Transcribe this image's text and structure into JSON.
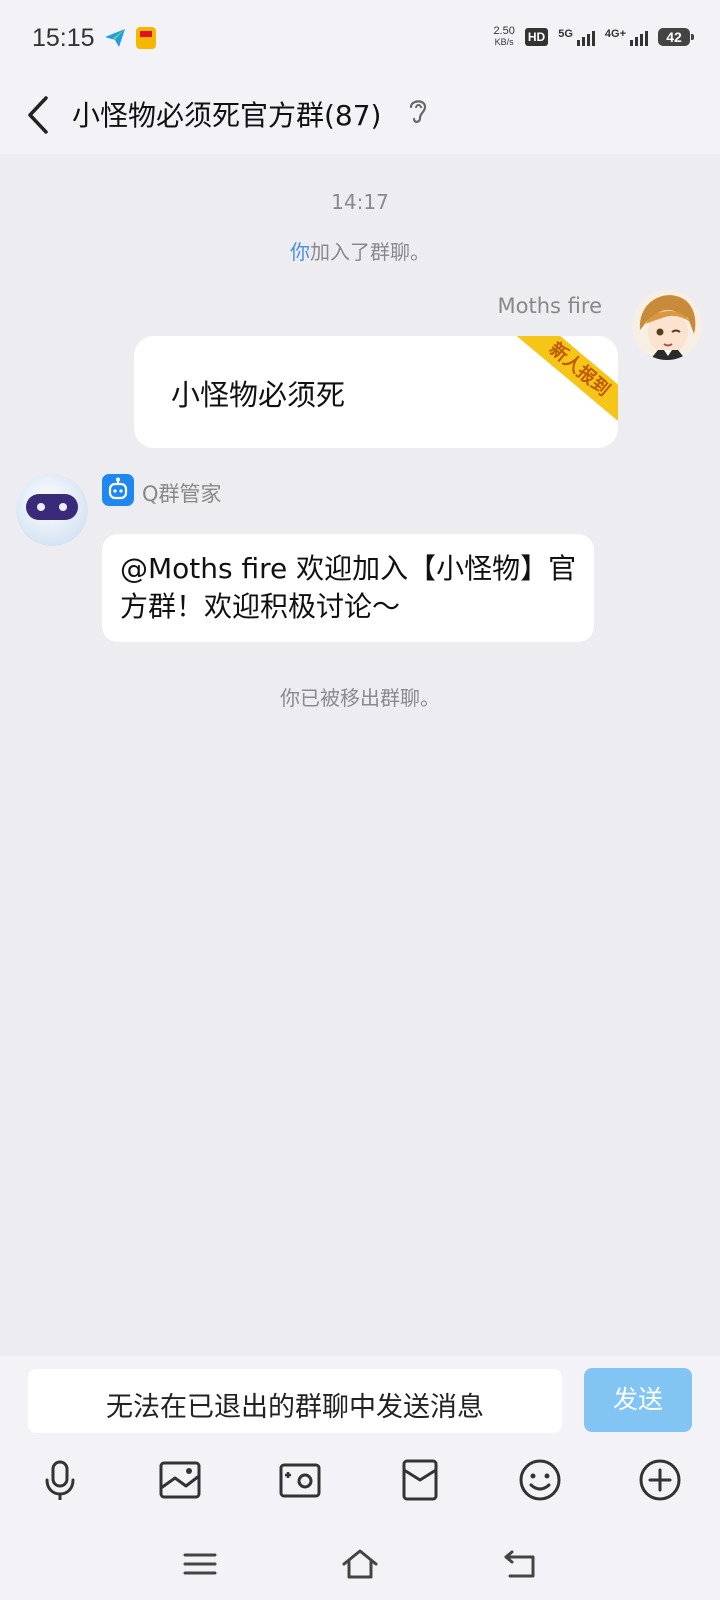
{
  "status_bar": {
    "time": "15:15",
    "net_speed": "2.50",
    "net_speed_unit": "KB/s",
    "hd_label": "HD",
    "sim1_label": "5G",
    "sim2_label": "4G+",
    "battery": "42"
  },
  "header": {
    "title": "小怪物必须死官方群(87)"
  },
  "chat": {
    "timestamp": "14:17",
    "join_notice": {
      "you": "你",
      "text": "加入了群聊。"
    },
    "outgoing": {
      "sender": "Moths fire",
      "text": "小怪物必须死",
      "badge": "新人报到"
    },
    "incoming": {
      "sender": "Q群管家",
      "text": "@Moths fire 欢迎加入【小怪物】官方群！欢迎积极讨论～"
    },
    "removed_notice": "你已被移出群聊。"
  },
  "composer": {
    "input_placeholder": "无法在已退出的群聊中发送消息",
    "send_label": "发送"
  },
  "toolbar": {
    "icons": [
      "microphone-icon",
      "image-icon",
      "camera-icon",
      "red-packet-icon",
      "emoji-icon",
      "plus-icon"
    ]
  },
  "nav": {
    "icons": [
      "menu-icon",
      "home-icon",
      "back-nav-icon"
    ]
  },
  "colors": {
    "accent": "#1e88f0",
    "send_disabled": "#7cc3f3",
    "badge": "#f5c518",
    "background": "#edecf1"
  }
}
